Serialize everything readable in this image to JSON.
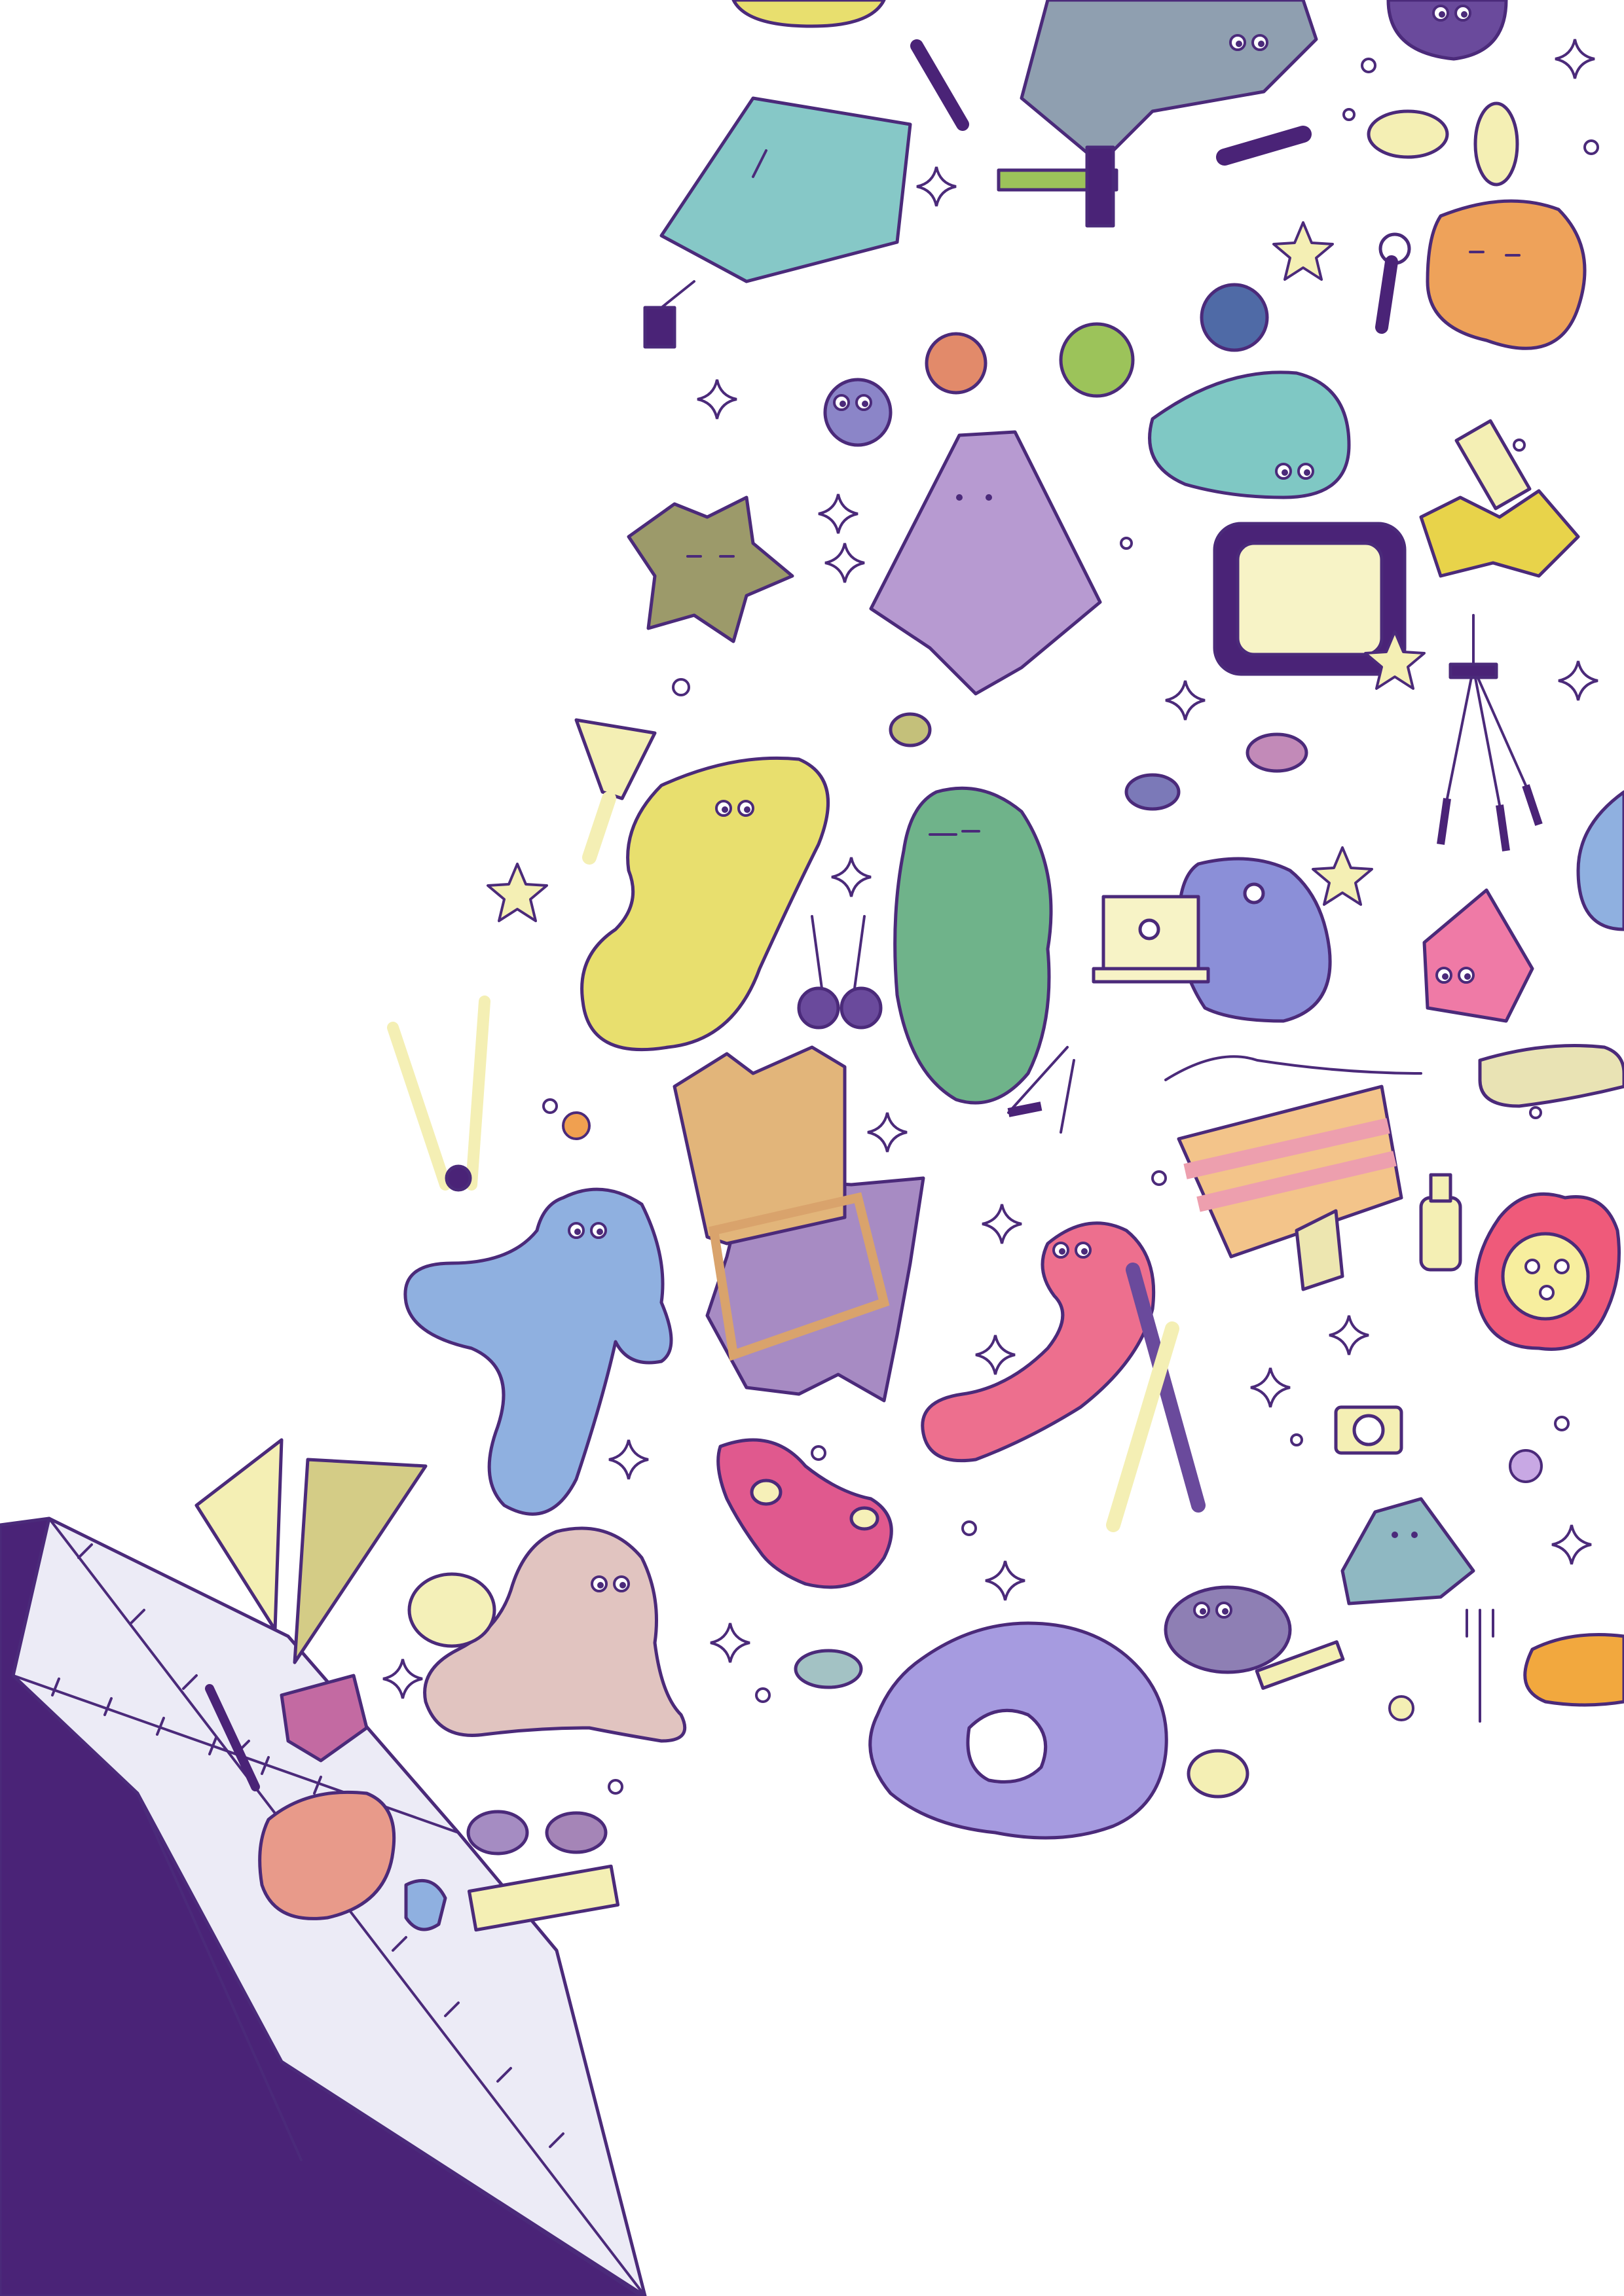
{
  "artwork": {
    "kind": "illustration",
    "colors": {
      "outline": "#4b2a7a",
      "box_dark": "#4a2377",
      "box_light": "#ecebf6",
      "yellow": "#ecdf7a",
      "green": "#6fb38a",
      "blue": "#8fb0e0",
      "pink": "#e86f98",
      "purple": "#b79ad1",
      "orange": "#eea25a",
      "teal": "#7fc8c4",
      "cream": "#f4f0b8"
    },
    "icons": [
      "paper-box-icon",
      "ghost-icon",
      "blob-character-icon",
      "star-icon",
      "sparkle-icon",
      "paintbrush-icon",
      "scissors-icon",
      "compass-icon",
      "set-square-icon",
      "camera-icon",
      "microphone-icon",
      "tripod-icon",
      "laptop-icon",
      "tv-icon",
      "bucket-hat-icon",
      "pencil-icon",
      "ruler-icon",
      "glue-bottle-icon",
      "fork-icon",
      "lion-icon"
    ]
  }
}
